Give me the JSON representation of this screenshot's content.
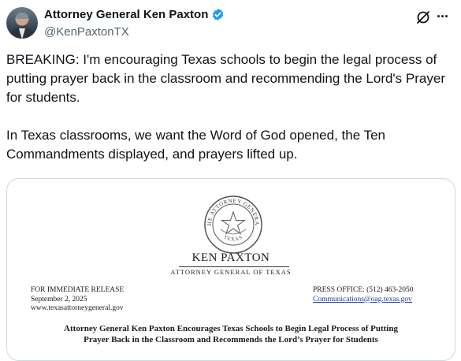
{
  "author": {
    "display_name": "Attorney General Ken Paxton",
    "handle": "@KenPaxtonTX",
    "verified": true,
    "verified_color": "#1d9bf0"
  },
  "actions": {
    "grok_icon": "grok-icon",
    "more_label": "···"
  },
  "tweet": {
    "text": "BREAKING: I'm encouraging Texas schools to begin the legal process of putting prayer back in the classroom and recommending the Lord's Prayer for students.\n\nIn Texas classrooms, we want the Word of God opened, the Ten Commandments displayed, and prayers lifted up."
  },
  "media": {
    "seal_top": "THE ATTORNEY GENERAL",
    "seal_bottom": "TEXAS",
    "name": "KEN PAXTON",
    "role": "ATTORNEY GENERAL OF TEXAS",
    "release": "FOR IMMEDIATE RELEASE",
    "date": "September 2, 2025",
    "website": "www.texasattorneygeneral.gov",
    "press_office": "PRESS OFFICE: (512) 463-2050",
    "email": "Communications@oag.texas.gov",
    "headline_line1": "Attorney General Ken Paxton Encourages Texas Schools to Begin Legal Process of Putting",
    "headline_line2": "Prayer Back in the Classroom and Recommends the Lord’s Prayer for Students"
  }
}
